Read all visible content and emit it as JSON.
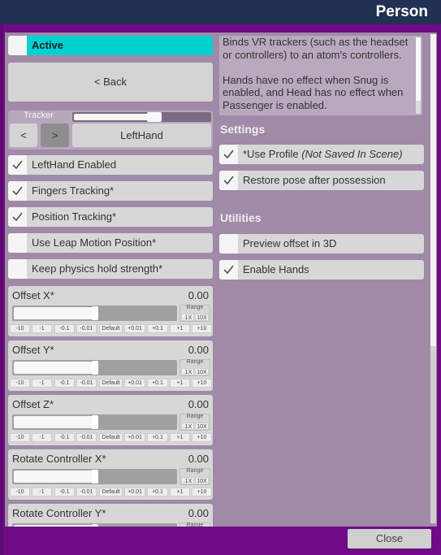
{
  "window": {
    "title": "Person"
  },
  "left": {
    "active": {
      "label": "Active",
      "checked": false
    },
    "back_button": "< Back",
    "tracker": {
      "label": "Tracker",
      "prev": "<",
      "next": ">",
      "value": "LeftHand",
      "slider_fraction": 0.6
    },
    "toggles": [
      {
        "label": "LeftHand Enabled",
        "checked": true
      },
      {
        "label": "Fingers Tracking*",
        "checked": true
      },
      {
        "label": "Position Tracking*",
        "checked": true
      },
      {
        "label": "Use Leap Motion Position*",
        "checked": false
      },
      {
        "label": "Keep physics hold strength*",
        "checked": false
      }
    ],
    "sliders": [
      {
        "name": "Offset X*",
        "value": "0.00",
        "fraction": 0.5
      },
      {
        "name": "Offset Y*",
        "value": "0.00",
        "fraction": 0.5
      },
      {
        "name": "Offset Z*",
        "value": "0.00",
        "fraction": 0.5
      },
      {
        "name": "Rotate Controller X*",
        "value": "0.00",
        "fraction": 0.5
      },
      {
        "name": "Rotate Controller Y*",
        "value": "0.00",
        "fraction": 0.5
      }
    ],
    "range": {
      "label": "Range",
      "small": ".1X",
      "large": "10X"
    },
    "steps": [
      "-10",
      "-1",
      "-0.1",
      "-0.01",
      "Default",
      "+0.01",
      "+0.1",
      "+1",
      "+10"
    ]
  },
  "right": {
    "description": "Binds VR trackers (such as the headset or controllers) to an atom's controllers.\n\nHands have no effect when Snug is enabled, and Head has no effect when Passenger is enabled.",
    "settings": {
      "title": "Settings",
      "items": [
        {
          "label": "*Use Profile ",
          "label_italic": "(Not Saved In Scene)",
          "checked": true
        },
        {
          "label": "Restore pose after possession",
          "label_italic": "",
          "checked": true
        }
      ]
    },
    "utilities": {
      "title": "Utilities",
      "items": [
        {
          "label": "Preview offset in 3D",
          "checked": false
        },
        {
          "label": "Enable Hands",
          "checked": true
        }
      ]
    }
  },
  "footer": {
    "close_label": "Close"
  }
}
